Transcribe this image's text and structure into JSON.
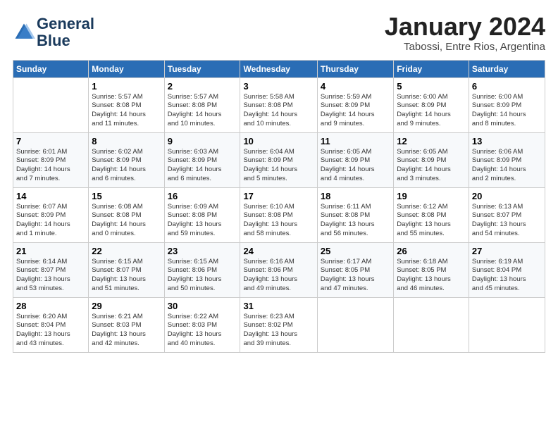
{
  "logo": {
    "line1": "General",
    "line2": "Blue"
  },
  "title": "January 2024",
  "subtitle": "Tabossi, Entre Rios, Argentina",
  "headers": [
    "Sunday",
    "Monday",
    "Tuesday",
    "Wednesday",
    "Thursday",
    "Friday",
    "Saturday"
  ],
  "weeks": [
    [
      {
        "day": "",
        "info": ""
      },
      {
        "day": "1",
        "info": "Sunrise: 5:57 AM\nSunset: 8:08 PM\nDaylight: 14 hours\nand 11 minutes."
      },
      {
        "day": "2",
        "info": "Sunrise: 5:57 AM\nSunset: 8:08 PM\nDaylight: 14 hours\nand 10 minutes."
      },
      {
        "day": "3",
        "info": "Sunrise: 5:58 AM\nSunset: 8:08 PM\nDaylight: 14 hours\nand 10 minutes."
      },
      {
        "day": "4",
        "info": "Sunrise: 5:59 AM\nSunset: 8:09 PM\nDaylight: 14 hours\nand 9 minutes."
      },
      {
        "day": "5",
        "info": "Sunrise: 6:00 AM\nSunset: 8:09 PM\nDaylight: 14 hours\nand 9 minutes."
      },
      {
        "day": "6",
        "info": "Sunrise: 6:00 AM\nSunset: 8:09 PM\nDaylight: 14 hours\nand 8 minutes."
      }
    ],
    [
      {
        "day": "7",
        "info": "Sunrise: 6:01 AM\nSunset: 8:09 PM\nDaylight: 14 hours\nand 7 minutes."
      },
      {
        "day": "8",
        "info": "Sunrise: 6:02 AM\nSunset: 8:09 PM\nDaylight: 14 hours\nand 6 minutes."
      },
      {
        "day": "9",
        "info": "Sunrise: 6:03 AM\nSunset: 8:09 PM\nDaylight: 14 hours\nand 6 minutes."
      },
      {
        "day": "10",
        "info": "Sunrise: 6:04 AM\nSunset: 8:09 PM\nDaylight: 14 hours\nand 5 minutes."
      },
      {
        "day": "11",
        "info": "Sunrise: 6:05 AM\nSunset: 8:09 PM\nDaylight: 14 hours\nand 4 minutes."
      },
      {
        "day": "12",
        "info": "Sunrise: 6:05 AM\nSunset: 8:09 PM\nDaylight: 14 hours\nand 3 minutes."
      },
      {
        "day": "13",
        "info": "Sunrise: 6:06 AM\nSunset: 8:09 PM\nDaylight: 14 hours\nand 2 minutes."
      }
    ],
    [
      {
        "day": "14",
        "info": "Sunrise: 6:07 AM\nSunset: 8:09 PM\nDaylight: 14 hours\nand 1 minute."
      },
      {
        "day": "15",
        "info": "Sunrise: 6:08 AM\nSunset: 8:08 PM\nDaylight: 14 hours\nand 0 minutes."
      },
      {
        "day": "16",
        "info": "Sunrise: 6:09 AM\nSunset: 8:08 PM\nDaylight: 13 hours\nand 59 minutes."
      },
      {
        "day": "17",
        "info": "Sunrise: 6:10 AM\nSunset: 8:08 PM\nDaylight: 13 hours\nand 58 minutes."
      },
      {
        "day": "18",
        "info": "Sunrise: 6:11 AM\nSunset: 8:08 PM\nDaylight: 13 hours\nand 56 minutes."
      },
      {
        "day": "19",
        "info": "Sunrise: 6:12 AM\nSunset: 8:08 PM\nDaylight: 13 hours\nand 55 minutes."
      },
      {
        "day": "20",
        "info": "Sunrise: 6:13 AM\nSunset: 8:07 PM\nDaylight: 13 hours\nand 54 minutes."
      }
    ],
    [
      {
        "day": "21",
        "info": "Sunrise: 6:14 AM\nSunset: 8:07 PM\nDaylight: 13 hours\nand 53 minutes."
      },
      {
        "day": "22",
        "info": "Sunrise: 6:15 AM\nSunset: 8:07 PM\nDaylight: 13 hours\nand 51 minutes."
      },
      {
        "day": "23",
        "info": "Sunrise: 6:15 AM\nSunset: 8:06 PM\nDaylight: 13 hours\nand 50 minutes."
      },
      {
        "day": "24",
        "info": "Sunrise: 6:16 AM\nSunset: 8:06 PM\nDaylight: 13 hours\nand 49 minutes."
      },
      {
        "day": "25",
        "info": "Sunrise: 6:17 AM\nSunset: 8:05 PM\nDaylight: 13 hours\nand 47 minutes."
      },
      {
        "day": "26",
        "info": "Sunrise: 6:18 AM\nSunset: 8:05 PM\nDaylight: 13 hours\nand 46 minutes."
      },
      {
        "day": "27",
        "info": "Sunrise: 6:19 AM\nSunset: 8:04 PM\nDaylight: 13 hours\nand 45 minutes."
      }
    ],
    [
      {
        "day": "28",
        "info": "Sunrise: 6:20 AM\nSunset: 8:04 PM\nDaylight: 13 hours\nand 43 minutes."
      },
      {
        "day": "29",
        "info": "Sunrise: 6:21 AM\nSunset: 8:03 PM\nDaylight: 13 hours\nand 42 minutes."
      },
      {
        "day": "30",
        "info": "Sunrise: 6:22 AM\nSunset: 8:03 PM\nDaylight: 13 hours\nand 40 minutes."
      },
      {
        "day": "31",
        "info": "Sunrise: 6:23 AM\nSunset: 8:02 PM\nDaylight: 13 hours\nand 39 minutes."
      },
      {
        "day": "",
        "info": ""
      },
      {
        "day": "",
        "info": ""
      },
      {
        "day": "",
        "info": ""
      }
    ]
  ]
}
